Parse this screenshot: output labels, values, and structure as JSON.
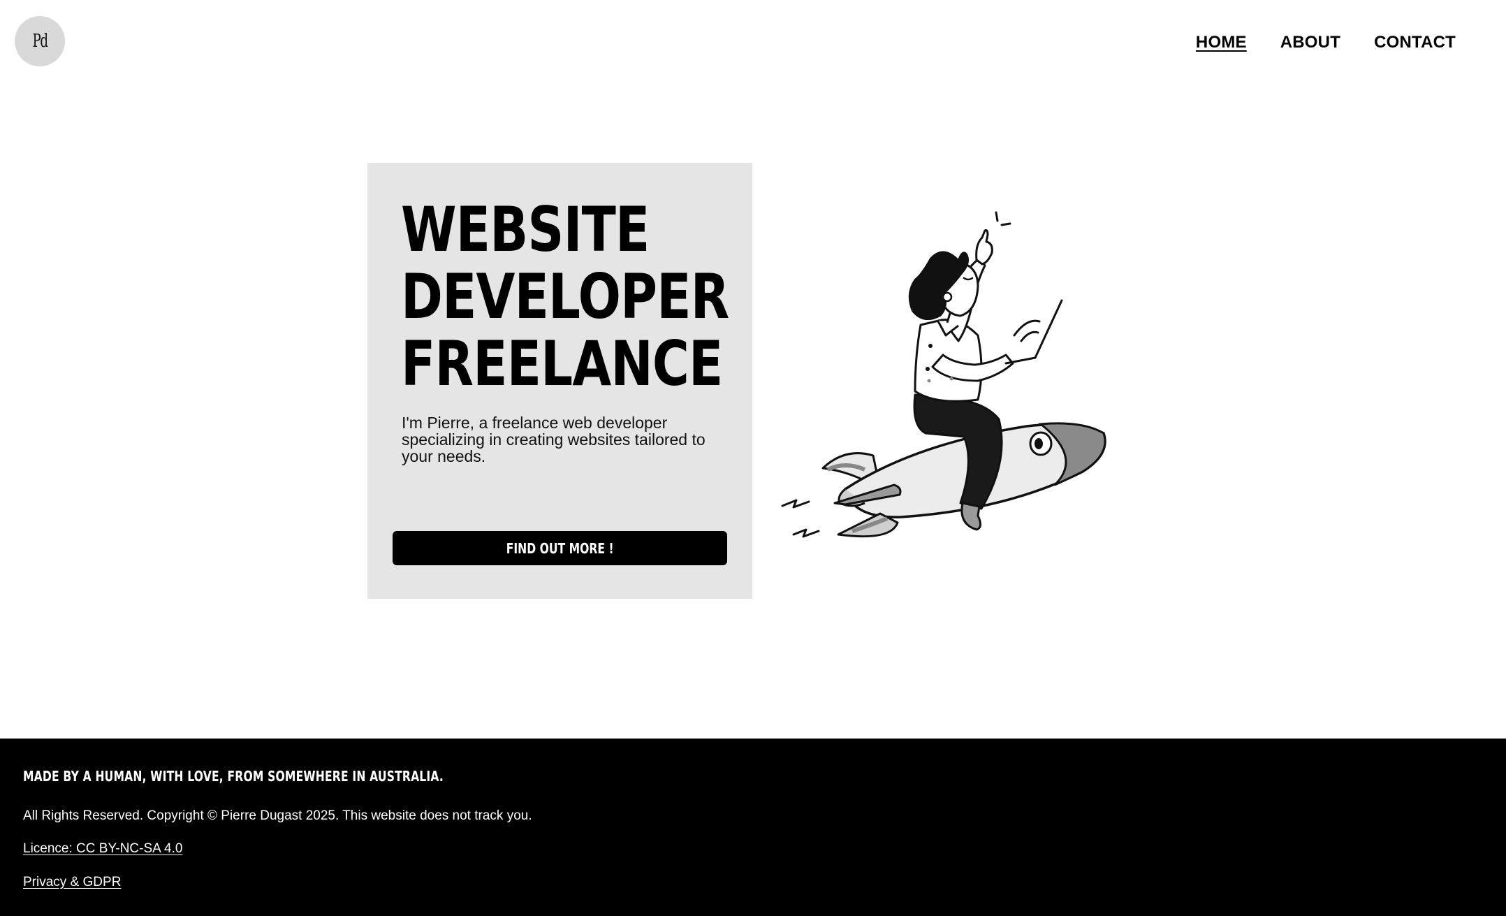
{
  "header": {
    "logo_text": "Pd",
    "nav": [
      {
        "label": "HOME",
        "active": true
      },
      {
        "label": "ABOUT",
        "active": false
      },
      {
        "label": "CONTACT",
        "active": false
      }
    ]
  },
  "hero": {
    "title_lines": [
      "WEBSITE",
      "DEVELOPER",
      "FREELANCE"
    ],
    "text": "I'm Pierre, a freelance web developer specializing in creating websites tailored to your needs.",
    "cta_label": "FIND OUT MORE !",
    "illustration": "person-riding-rocket-illustration"
  },
  "footer": {
    "tagline": "MADE BY A HUMAN, WITH LOVE, FROM SOMEWHERE IN AUSTRALIA.",
    "copyright": "All Rights Reserved. Copyright © Pierre Dugast 2025. This website does not track you.",
    "licence_link": "Licence: CC BY-NC-SA 4.0",
    "privacy_link": "Privacy & GDPR"
  },
  "colors": {
    "background": "#ffffff",
    "card": "#e5e5e5",
    "logo_bg": "#d9d9d9",
    "footer_bg": "#000000",
    "button_bg": "#000000",
    "text": "#000000"
  }
}
